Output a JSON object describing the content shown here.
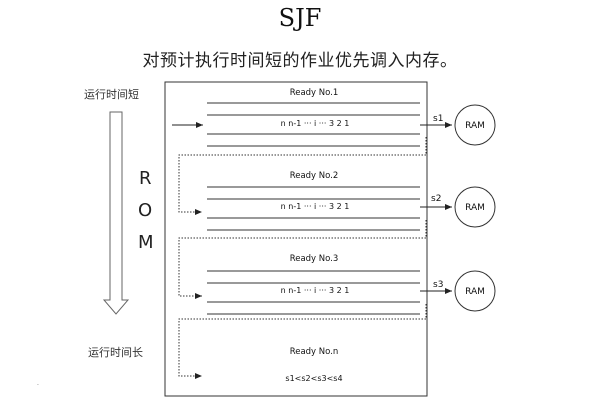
{
  "title": "SJF",
  "subtitle": "对预计执行时间短的作业优先调入内存。",
  "left": {
    "top_label": "运行时间短",
    "bottom_label": "运行时间长",
    "rom_letters": [
      "R",
      "O",
      "M"
    ]
  },
  "queues": [
    {
      "label": "Ready No.1",
      "sequence": "n   n-1   ··· i ··· 3   2   1",
      "out_label": "s1",
      "ram_label": "RAM"
    },
    {
      "label": "Ready No.2",
      "sequence": "n   n-1   ··· i ··· 3   2   1",
      "out_label": "s2",
      "ram_label": "RAM"
    },
    {
      "label": "Ready No.3",
      "sequence": "n   n-1   ··· i ··· 3   2   1",
      "out_label": "s3",
      "ram_label": "RAM"
    }
  ],
  "last_queue": {
    "label": "Ready No.n",
    "condition": "s1<s2<s3<s4"
  }
}
